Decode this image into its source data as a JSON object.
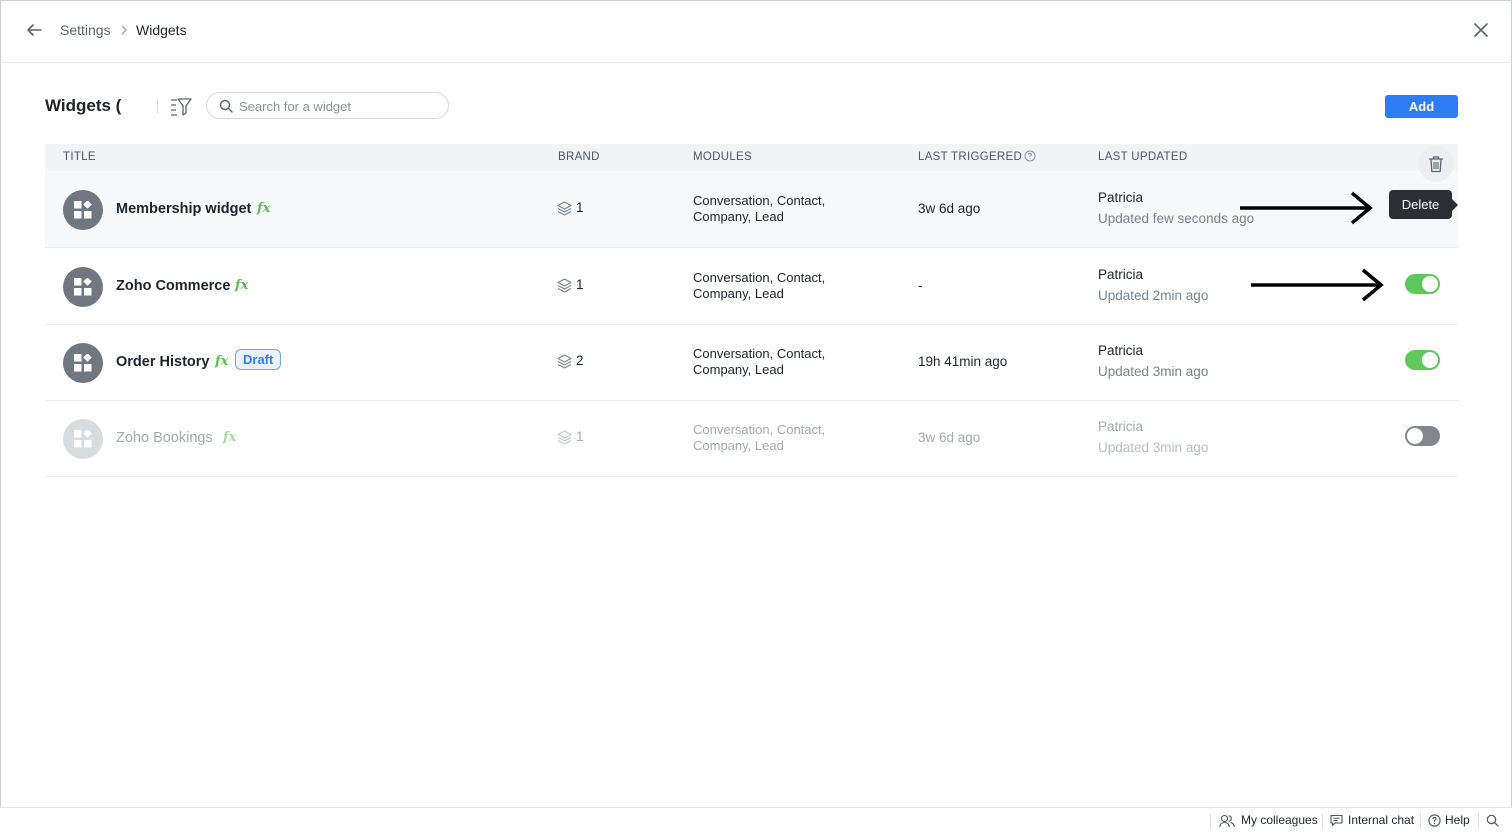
{
  "breadcrumb": {
    "parent": "Settings",
    "current": "Widgets"
  },
  "header": {
    "title": "Widgets (",
    "search_placeholder": "Search for a widget",
    "add_label": "Add"
  },
  "table": {
    "columns": {
      "title": "TITLE",
      "brand": "BRAND",
      "modules": "MODULES",
      "last_triggered": "LAST TRIGGERED",
      "last_updated": "LAST UPDATED"
    },
    "rows": [
      {
        "name": "Membership widget",
        "fx": "fx",
        "brand": "1",
        "modules": "Conversation, Contact, Company, Lead",
        "last_triggered": "3w 6d ago",
        "updated_by": "Patricia",
        "updated_time": "Updated few seconds ago",
        "enabled": true
      },
      {
        "name": "Zoho Commerce",
        "fx": "fx",
        "brand": "1",
        "modules": "Conversation, Contact, Company, Lead",
        "last_triggered": "-",
        "updated_by": "Patricia",
        "updated_time": "Updated 2min ago",
        "enabled": true
      },
      {
        "name": "Order History",
        "fx": "fx",
        "badge": "Draft",
        "brand": "2",
        "modules": "Conversation, Contact, Company, Lead",
        "last_triggered": "19h 41min ago",
        "updated_by": "Patricia",
        "updated_time": "Updated 3min ago",
        "enabled": true
      },
      {
        "name": "Zoho Bookings",
        "fx": "fx",
        "brand": "1",
        "modules": "Conversation, Contact, Company, Lead",
        "last_triggered": "3w 6d ago",
        "updated_by": "Patricia",
        "updated_time": "Updated 3min ago",
        "enabled": false
      }
    ]
  },
  "tooltip": {
    "delete": "Delete"
  },
  "footer": {
    "colleagues": "My colleagues",
    "chat": "Internal chat",
    "help": "Help"
  },
  "colors": {
    "accent": "#2e7cf6",
    "toggle_on": "#5fc85a",
    "toggle_off": "#80878f",
    "fx_green": "#5fb85a"
  }
}
